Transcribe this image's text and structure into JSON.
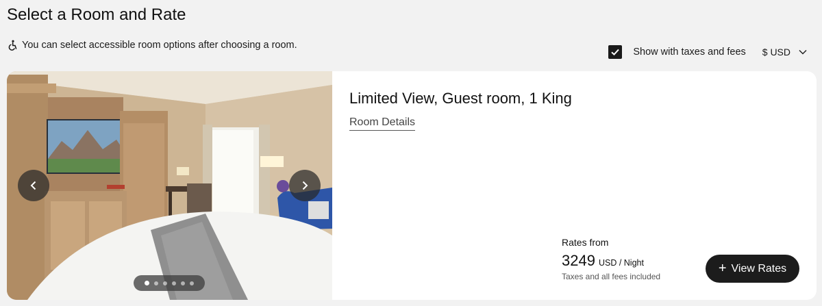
{
  "header": {
    "title": "Select a Room and Rate"
  },
  "notice": {
    "icon": "accessible-icon",
    "text": "You can select accessible room options after choosing a room."
  },
  "controls": {
    "tax_checkbox_checked": true,
    "tax_label": "Show with taxes and fees",
    "currency_label": "$ USD"
  },
  "room": {
    "name": "Limited View, Guest room, 1 King",
    "details_link": "Room Details",
    "gallery": {
      "image_count": 6,
      "active_index": 0
    },
    "rates_from_label": "Rates from",
    "price": "3249",
    "price_unit": "USD / Night",
    "fees_note": "Taxes and all fees included",
    "view_rates_label": "View Rates"
  },
  "colors": {
    "page_bg": "#f2f2f2",
    "card_bg": "#ffffff",
    "button_bg": "#1c1c1c",
    "button_text": "#ffffff"
  }
}
